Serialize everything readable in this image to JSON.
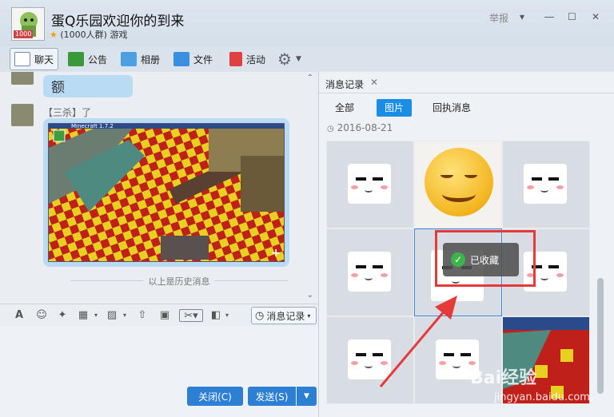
{
  "header": {
    "group_name": "蛋Q乐园欢迎你的到来",
    "group_info": "(1000人群) 游戏",
    "avatar_badge": "1000",
    "report_label": "举报"
  },
  "toolbar": {
    "chat": "聊天",
    "announcement": "公告",
    "album": "相册",
    "files": "文件",
    "activity": "活动"
  },
  "chat": {
    "message1": "额",
    "sender2": "【三杀】了",
    "history_divider": "以上是历史消息",
    "image_caption": "Minecraft 1.7.2"
  },
  "input_toolbar": {
    "history_button": "消息记录"
  },
  "buttons": {
    "close": "关闭(C)",
    "send": "发送(S)"
  },
  "right_panel": {
    "tab_title": "消息记录",
    "subtabs": [
      "全部",
      "图片",
      "回执消息"
    ],
    "active_subtab": "图片",
    "date": "2016-08-21",
    "toast": "已收藏"
  },
  "watermark": {
    "brand": "Bai经验",
    "url": "jingyan.baidu.com"
  },
  "colors": {
    "accent": "#2d7fd4",
    "tab_active": "#1a8ee6",
    "highlight": "#e53a3a",
    "success": "#3bb54a"
  }
}
